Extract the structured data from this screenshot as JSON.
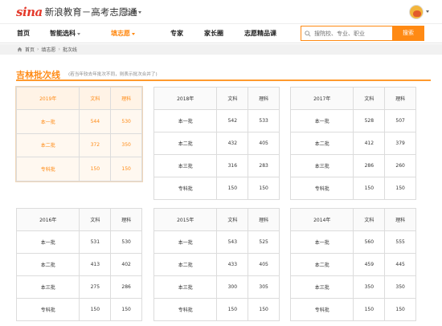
{
  "header": {
    "logo_brand": "sina",
    "logo_text": "新浪教育－高考志愿通",
    "region": "吉林"
  },
  "nav": {
    "items": [
      {
        "label": "首页"
      },
      {
        "label": "智能选科"
      },
      {
        "label": "填志愿"
      },
      {
        "label": "专家"
      },
      {
        "label": "家长圈"
      },
      {
        "label": "志愿精品课"
      }
    ],
    "active": "填志愿"
  },
  "search": {
    "placeholder": "搜院校、专业、职业",
    "button_label": "搜索"
  },
  "breadcrumb": {
    "items": [
      "首页",
      "填志愿",
      "批次线"
    ]
  },
  "page": {
    "title": "吉林批次线",
    "note": "(若当年较去年批次不同，则表示批次合并了)"
  },
  "colors": {
    "accent": "#ff8a14",
    "brand_red": "#e4392b"
  },
  "tables": [
    {
      "year": "2019年",
      "col_wenke": "文科",
      "col_like": "理科",
      "rows": [
        {
          "batch": "本一批",
          "wenke": "544",
          "like": "530"
        },
        {
          "batch": "本二批",
          "wenke": "372",
          "like": "350"
        },
        {
          "batch": "专科批",
          "wenke": "150",
          "like": "150"
        }
      ]
    },
    {
      "year": "2018年",
      "col_wenke": "文科",
      "col_like": "理科",
      "rows": [
        {
          "batch": "本一批",
          "wenke": "542",
          "like": "533"
        },
        {
          "batch": "本二批",
          "wenke": "432",
          "like": "405"
        },
        {
          "batch": "本三批",
          "wenke": "316",
          "like": "283"
        },
        {
          "batch": "专科批",
          "wenke": "150",
          "like": "150"
        }
      ]
    },
    {
      "year": "2017年",
      "col_wenke": "文科",
      "col_like": "理科",
      "rows": [
        {
          "batch": "本一批",
          "wenke": "528",
          "like": "507"
        },
        {
          "batch": "本二批",
          "wenke": "412",
          "like": "379"
        },
        {
          "batch": "本三批",
          "wenke": "286",
          "like": "260"
        },
        {
          "batch": "专科批",
          "wenke": "150",
          "like": "150"
        }
      ]
    },
    {
      "year": "2016年",
      "col_wenke": "文科",
      "col_like": "理科",
      "rows": [
        {
          "batch": "本一批",
          "wenke": "531",
          "like": "530"
        },
        {
          "batch": "本二批",
          "wenke": "413",
          "like": "402"
        },
        {
          "batch": "本三批",
          "wenke": "275",
          "like": "286"
        },
        {
          "batch": "专科批",
          "wenke": "150",
          "like": "150"
        }
      ]
    },
    {
      "year": "2015年",
      "col_wenke": "文科",
      "col_like": "理科",
      "rows": [
        {
          "batch": "本一批",
          "wenke": "543",
          "like": "525"
        },
        {
          "batch": "本二批",
          "wenke": "433",
          "like": "405"
        },
        {
          "batch": "本三批",
          "wenke": "300",
          "like": "305"
        },
        {
          "batch": "专科批",
          "wenke": "150",
          "like": "150"
        }
      ]
    },
    {
      "year": "2014年",
      "col_wenke": "文科",
      "col_like": "理科",
      "rows": [
        {
          "batch": "本一批",
          "wenke": "560",
          "like": "555"
        },
        {
          "batch": "本二批",
          "wenke": "459",
          "like": "445"
        },
        {
          "batch": "本三批",
          "wenke": "350",
          "like": "350"
        },
        {
          "batch": "专科批",
          "wenke": "150",
          "like": "150"
        }
      ]
    }
  ]
}
